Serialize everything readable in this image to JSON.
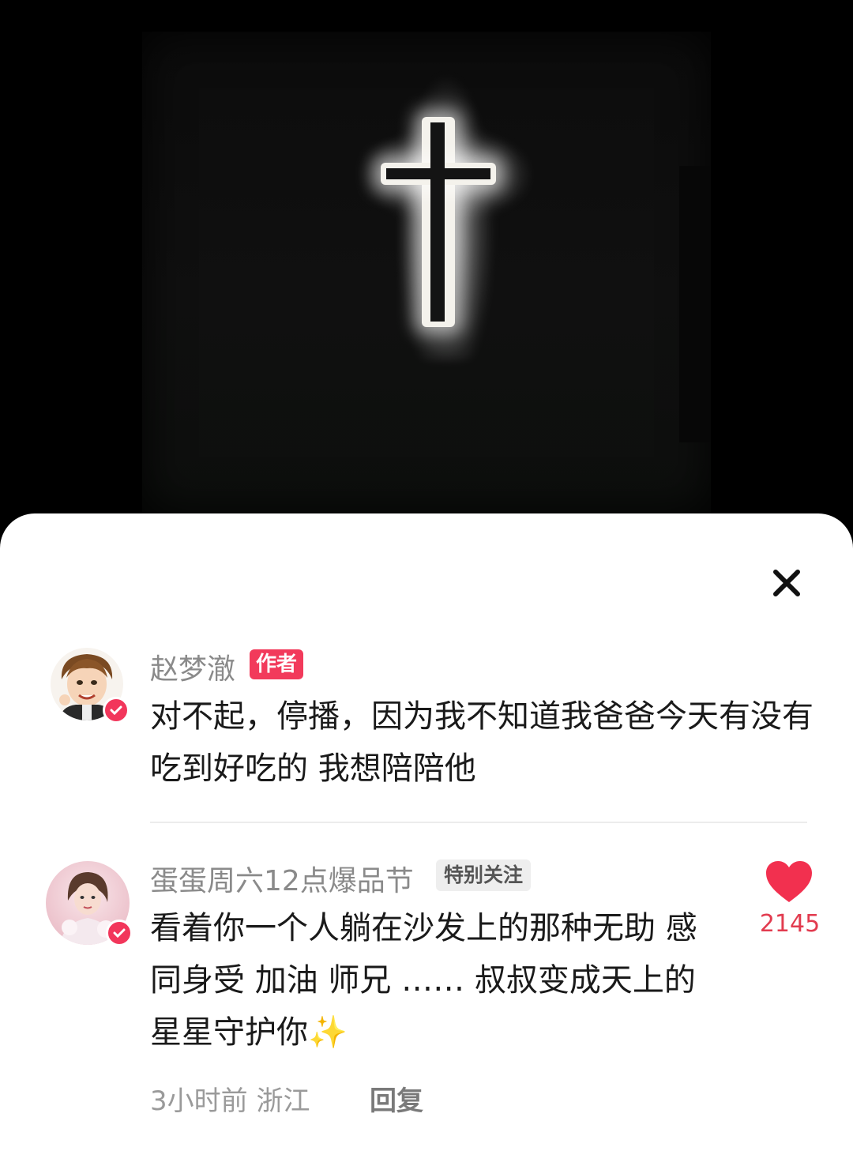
{
  "sheet": {
    "title": "",
    "close_icon": "close-icon"
  },
  "comments": [
    {
      "username": "赵梦澈",
      "badge": "作者",
      "text": "对不起，停播，因为我不知道我爸爸今天有没有吃到好吃的 我想陪陪他",
      "avatar_icon": "avatar-cartoon-male",
      "verified_icon": "verified-icon"
    },
    {
      "username": "蛋蛋周六12点爆品节",
      "badge": "特别关注",
      "text": "看着你一个人躺在沙发上的那种无助 感同身受 加油 师兄 …… 叔叔变成天上的星星守护你✨",
      "avatar_icon": "avatar-photo-female",
      "verified_icon": "verified-icon",
      "likes": "2145",
      "like_icon": "heart-icon",
      "time": "3小时前",
      "location": "浙江",
      "reply_label": "回复"
    }
  ],
  "colors": {
    "accent": "#f23a5b",
    "like": "#e23b4f",
    "username": "#8a8a8a",
    "text": "#1a1a1a"
  }
}
